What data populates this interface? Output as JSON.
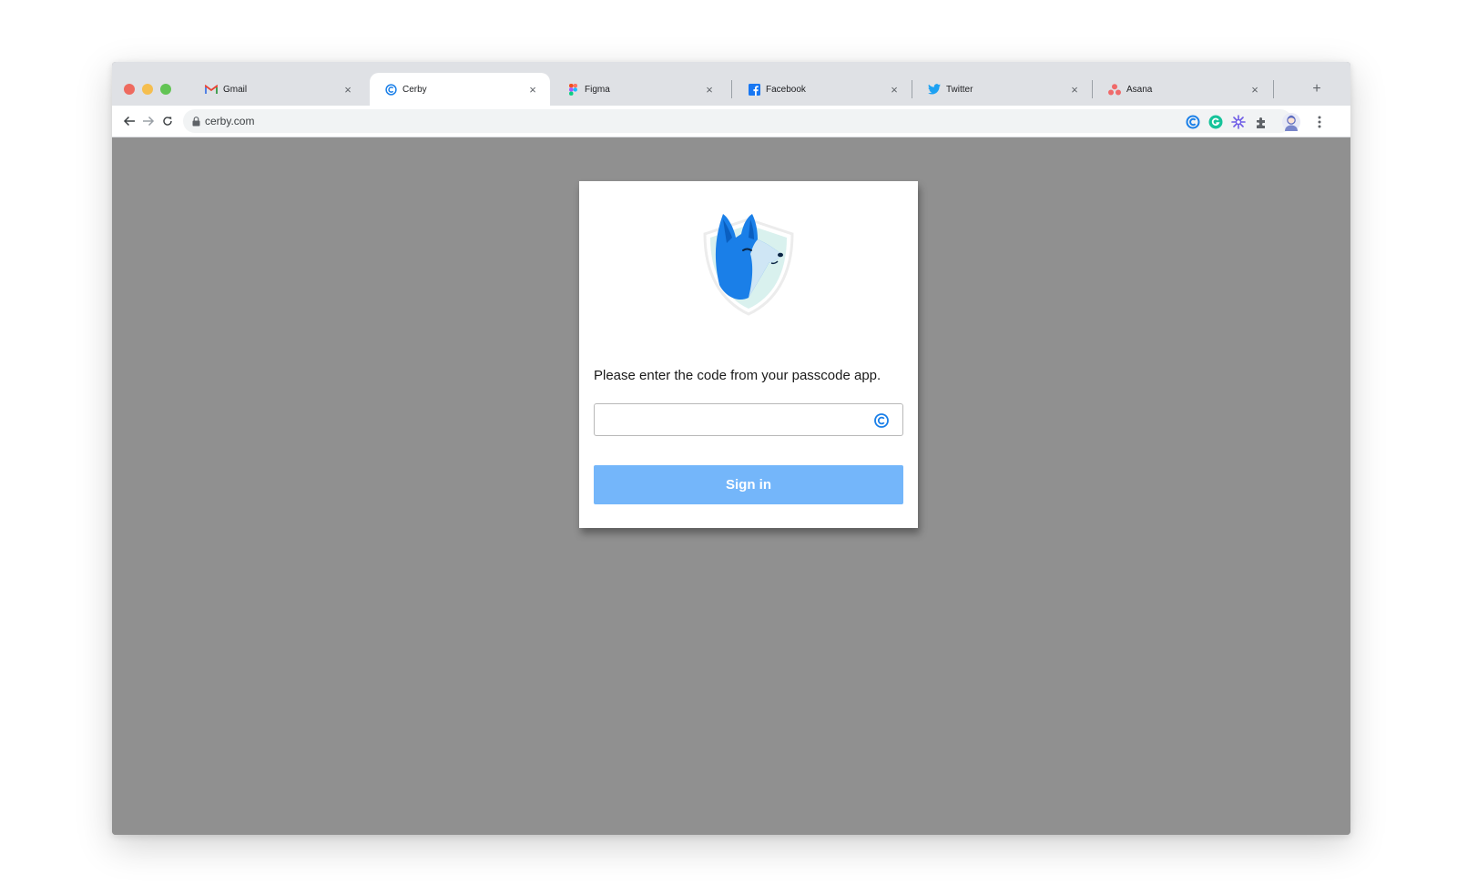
{
  "browser": {
    "tabs": [
      {
        "label": "Gmail",
        "icon": "gmail-icon",
        "active": false
      },
      {
        "label": "Cerby",
        "icon": "cerby-icon",
        "active": true
      },
      {
        "label": "Figma",
        "icon": "figma-icon",
        "active": false
      },
      {
        "label": "Facebook",
        "icon": "facebook-icon",
        "active": false
      },
      {
        "label": "Twitter",
        "icon": "twitter-icon",
        "active": false
      },
      {
        "label": "Asana",
        "icon": "asana-icon",
        "active": false
      }
    ],
    "close_glyph": "×",
    "new_tab_glyph": "+",
    "url": "cerby.com",
    "extensions": [
      "cerby-extension-icon",
      "grammarly-extension-icon",
      "snowflake-extension-icon",
      "puzzle-extensions-icon",
      "profile-avatar-icon",
      "more-menu-icon"
    ]
  },
  "login": {
    "prompt": "Please enter the code from your passcode app.",
    "code_value": "",
    "button_label": "Sign in"
  },
  "colors": {
    "page_overlay": "#909090",
    "button": "#74b6fa",
    "cerby_blue": "#1a7fe8"
  }
}
